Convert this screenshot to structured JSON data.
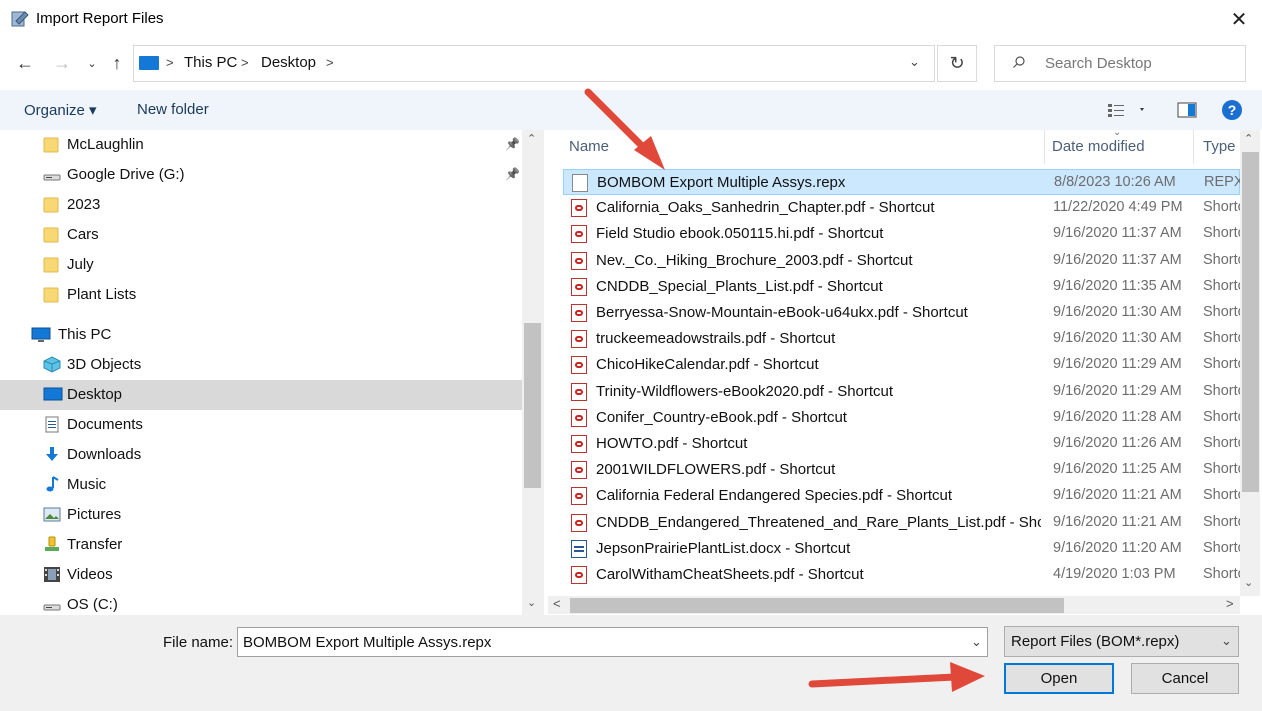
{
  "window": {
    "title": "Import Report Files"
  },
  "address": {
    "crumbs": [
      "This PC",
      "Desktop"
    ]
  },
  "search": {
    "placeholder": "Search Desktop"
  },
  "toolbar": {
    "organize": "Organize ▾",
    "new_folder": "New folder"
  },
  "nav_items": [
    {
      "label": "McLaughlin",
      "icon": "folder-icon",
      "pinned": true
    },
    {
      "label": "Google Drive (G:)",
      "icon": "drive-icon",
      "pinned": true
    },
    {
      "label": "2023",
      "icon": "folder-icon"
    },
    {
      "label": "Cars",
      "icon": "folder-icon"
    },
    {
      "label": "July",
      "icon": "folder-icon"
    },
    {
      "label": "Plant Lists",
      "icon": "folder-icon"
    },
    {
      "label": "This PC",
      "icon": "pc-icon"
    },
    {
      "label": "3D Objects",
      "icon": "cube-icon"
    },
    {
      "label": "Desktop",
      "icon": "desktop-icon",
      "selected": true
    },
    {
      "label": "Documents",
      "icon": "documents-icon"
    },
    {
      "label": "Downloads",
      "icon": "download-icon"
    },
    {
      "label": "Music",
      "icon": "music-icon"
    },
    {
      "label": "Pictures",
      "icon": "pictures-icon"
    },
    {
      "label": "Transfer",
      "icon": "transfer-icon"
    },
    {
      "label": "Videos",
      "icon": "videos-icon"
    },
    {
      "label": "OS (C:)",
      "icon": "drive-icon"
    }
  ],
  "columns": {
    "name": "Name",
    "date": "Date modified",
    "type": "Type"
  },
  "files": [
    {
      "name": "BOMBOM Export Multiple Assys.repx",
      "date": "8/8/2023 10:26 AM",
      "type": "REPX",
      "icon": "blank",
      "selected": true
    },
    {
      "name": "California_Oaks_Sanhedrin_Chapter.pdf - Shortcut",
      "date": "11/22/2020 4:49 PM",
      "type": "Shortcut",
      "icon": "pdf"
    },
    {
      "name": "Field Studio ebook.050115.hi.pdf - Shortcut",
      "date": "9/16/2020 11:37 AM",
      "type": "Shortcut",
      "icon": "pdf"
    },
    {
      "name": "Nev._Co._Hiking_Brochure_2003.pdf - Shortcut",
      "date": "9/16/2020 11:37 AM",
      "type": "Shortcut",
      "icon": "pdf"
    },
    {
      "name": "CNDDB_Special_Plants_List.pdf - Shortcut",
      "date": "9/16/2020 11:35 AM",
      "type": "Shortcut",
      "icon": "pdf"
    },
    {
      "name": "Berryessa-Snow-Mountain-eBook-u64ukx.pdf - Shortcut",
      "date": "9/16/2020 11:30 AM",
      "type": "Shortcut",
      "icon": "pdf"
    },
    {
      "name": "truckeemeadowstrails.pdf - Shortcut",
      "date": "9/16/2020 11:30 AM",
      "type": "Shortcut",
      "icon": "pdf"
    },
    {
      "name": "ChicoHikeCalendar.pdf - Shortcut",
      "date": "9/16/2020 11:29 AM",
      "type": "Shortcut",
      "icon": "pdf"
    },
    {
      "name": "Trinity-Wildflowers-eBook2020.pdf - Shortcut",
      "date": "9/16/2020 11:29 AM",
      "type": "Shortcut",
      "icon": "pdf"
    },
    {
      "name": "Conifer_Country-eBook.pdf - Shortcut",
      "date": "9/16/2020 11:28 AM",
      "type": "Shortcut",
      "icon": "pdf"
    },
    {
      "name": "HOWTO.pdf - Shortcut",
      "date": "9/16/2020 11:26 AM",
      "type": "Shortcut",
      "icon": "pdf"
    },
    {
      "name": "2001WILDFLOWERS.pdf - Shortcut",
      "date": "9/16/2020 11:25 AM",
      "type": "Shortcut",
      "icon": "pdf"
    },
    {
      "name": "California Federal Endangered Species.pdf - Shortcut",
      "date": "9/16/2020 11:21 AM",
      "type": "Shortcut",
      "icon": "pdf"
    },
    {
      "name": "CNDDB_Endangered_Threatened_and_Rare_Plants_List.pdf - Shor...",
      "date": "9/16/2020 11:21 AM",
      "type": "Shortcut",
      "icon": "pdf"
    },
    {
      "name": "JepsonPrairiePlantList.docx - Shortcut",
      "date": "9/16/2020 11:20 AM",
      "type": "Shortcut",
      "icon": "doc"
    },
    {
      "name": "CarolWithamCheatSheets.pdf - Shortcut",
      "date": "4/19/2020 1:03 PM",
      "type": "Shortcut",
      "icon": "pdf"
    }
  ],
  "bottom": {
    "file_name_label": "File name:",
    "file_name_value": "BOMBOM Export Multiple Assys.repx",
    "file_type_value": "Report Files (BOM*.repx)",
    "open_label": "Open",
    "cancel_label": "Cancel"
  },
  "colors": {
    "accent": "#0078d7",
    "selection": "#cce8ff",
    "annotation_arrow": "#e0483a"
  }
}
